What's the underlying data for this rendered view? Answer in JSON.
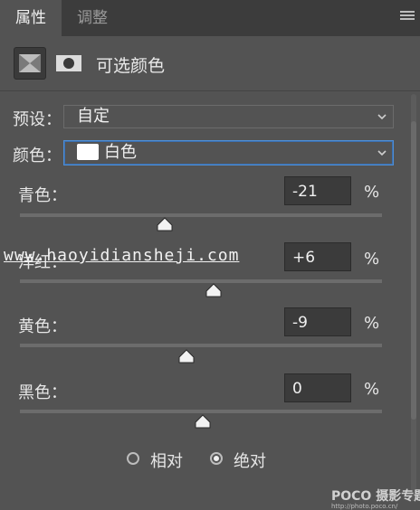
{
  "tabs": [
    {
      "label": "属性",
      "active": true
    },
    {
      "label": "调整",
      "active": false
    }
  ],
  "header": {
    "title": "可选颜色",
    "icon_adjustment": "selective-color-icon",
    "icon_mask": "layer-mask-icon"
  },
  "preset": {
    "label": "预设：",
    "value": "自定"
  },
  "colors": {
    "label": "颜色：",
    "value": "白色",
    "swatch": "#ffffff"
  },
  "channels": [
    {
      "label": "青色：",
      "value": "-21",
      "unit": "%",
      "slider_level": -21
    },
    {
      "label": "洋红：",
      "value": "+6",
      "unit": "%",
      "slider_level": 6
    },
    {
      "label": "黄色：",
      "value": "-9",
      "unit": "%",
      "slider_level": -9
    },
    {
      "label": "黑色：",
      "value": "0",
      "unit": "%",
      "slider_level": 0
    }
  ],
  "method": {
    "options": [
      {
        "label": "相对",
        "selected": false
      },
      {
        "label": "绝对",
        "selected": true
      }
    ]
  },
  "watermark": {
    "text": "www.haoyidiansheji.com"
  },
  "branding": {
    "name": "POCO 摄影专题",
    "url": "http://photo.poco.cn/"
  },
  "colors_theme": {
    "panel": "#535353",
    "tabbar": "#3c3c3c",
    "focus": "#4f8fd6"
  }
}
